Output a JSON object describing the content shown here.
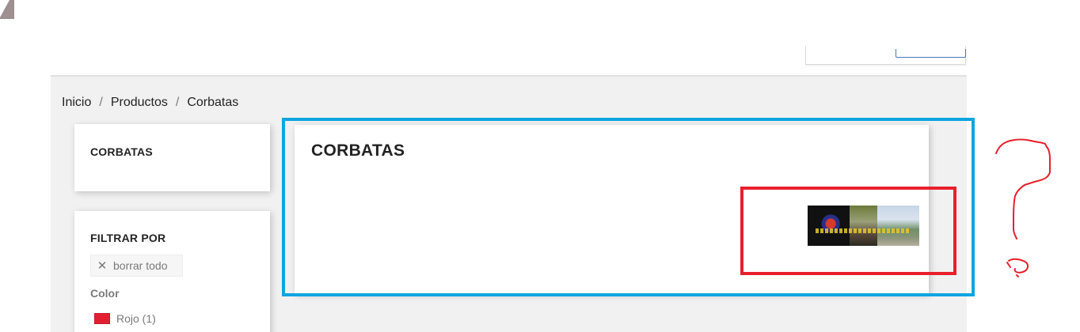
{
  "breadcrumb": {
    "items": [
      "Inicio",
      "Productos",
      "Corbatas"
    ],
    "separator": "/"
  },
  "sidebar": {
    "category_title": "CORBATAS",
    "filters": {
      "title": "FILTRAR POR",
      "clear_all_label": "borrar todo",
      "facet_title": "Color",
      "facet_items": [
        {
          "label": "Rojo (1)",
          "swatch_color": "#e21f31"
        }
      ]
    }
  },
  "main": {
    "category_heading": "CORBATAS"
  },
  "annotations": {
    "blue_box_color": "#0ea5e0",
    "red_box_color": "#e8202c",
    "question_mark_color": "#e8202c"
  },
  "icons": {
    "clear_filter": "close-icon",
    "annotation_mark": "question-mark-icon"
  }
}
